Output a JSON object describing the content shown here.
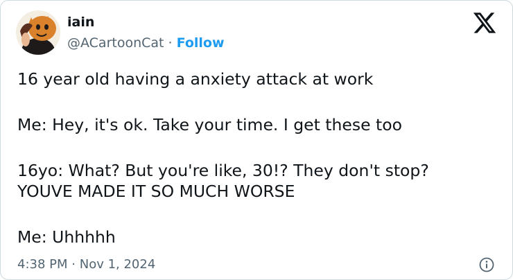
{
  "author": {
    "name": "iain",
    "handle": "@ACartoonCat",
    "separator": "·",
    "follow_label": "Follow"
  },
  "tweet": {
    "paragraphs": [
      "16 year old having a anxiety attack at work",
      "Me: Hey, it's ok. Take your time. I get these too",
      "16yo: What? But you're like, 30!? They don't stop?\nYOUVE MADE IT SO MUCH WORSE",
      "Me: Uhhhhh"
    ]
  },
  "meta": {
    "time": "4:38 PM",
    "separator": "·",
    "date": "Nov 1, 2024"
  },
  "icons": {
    "brand": "x-logo-icon",
    "info": "info-icon"
  },
  "colors": {
    "text": "#0f1419",
    "secondary": "#536471",
    "accent": "#1d9bf0",
    "border": "#cfd9de"
  }
}
